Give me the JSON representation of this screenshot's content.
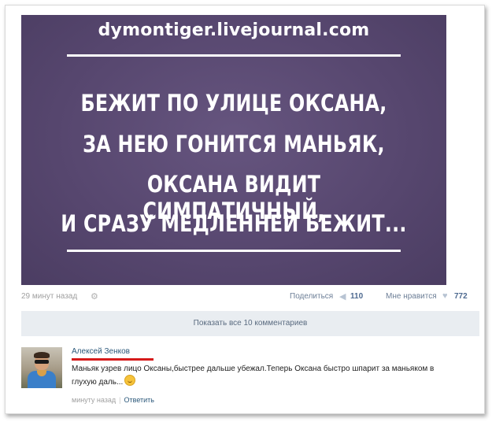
{
  "watermark": "dymontiger.livejournal.com",
  "poster": {
    "lines": [
      "БЕЖИТ ПО УЛИЦЕ ОКСАНА,",
      "ЗА НЕЮ ГОНИТСЯ МАНЬЯК,",
      "ОКСАНА ВИДИТ СИМПАТИЧНЫЙ,",
      "И СРАЗУ МЕДЛЕННЕЙ БЕЖИТ..."
    ],
    "background_color": "#5a4a73"
  },
  "post_meta": {
    "timestamp": "29 минут назад",
    "share_label": "Поделиться",
    "share_count": "110",
    "like_label": "Мне нравится",
    "like_count": "772",
    "icons": [
      "gear-icon",
      "share-icon",
      "heart-icon"
    ]
  },
  "show_comments_label": "Показать все 10 комментариев",
  "comment": {
    "author": "Алексей Зенков",
    "text": "Маньяк узрев лицо Оксаны,быстрее дальше убежал.Теперь Оксана быстро шпарит за маньяком в глухую даль...",
    "emoji": "smile-icon",
    "time": "минуту назад",
    "reply_label": "Ответить"
  },
  "colors": {
    "link": "#2b587a",
    "highlight_underline": "#d51a1a",
    "panel": "#e9edf1"
  }
}
